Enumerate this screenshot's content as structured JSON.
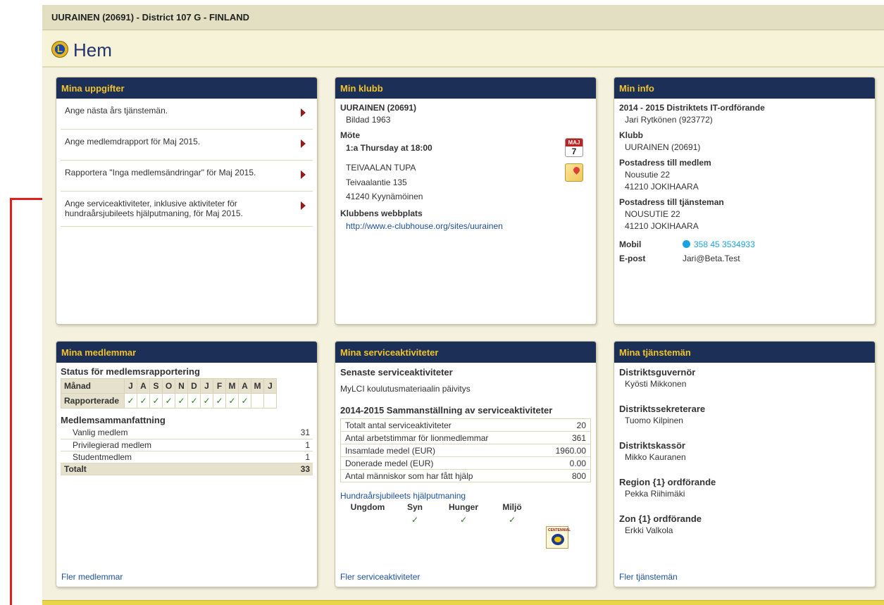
{
  "header": {
    "title": "UURAINEN (20691) - District 107 G - FINLAND",
    "page_title": "Hem",
    "logo_letter": "L"
  },
  "mina_uppgifter": {
    "title": "Mina uppgifter",
    "tasks": [
      "Ange nästa års tjänstemän.",
      "Ange medlemdrapport för Maj 2015.",
      "Rapportera \"Inga medlemsändringar\" för Maj 2015.",
      "Ange serviceaktiviteter, inklusive aktiviteter för hundraårsjubileets hjälputmaning, för Maj 2015."
    ]
  },
  "min_klubb": {
    "title": "Min klubb",
    "club": "UURAINEN (20691)",
    "founded": "Bildad 1963",
    "meeting_label": "Möte",
    "meeting_time": "1:a Thursday at 18:00",
    "cal_month": "MAJ",
    "cal_day": "7",
    "place": "TEIVAALAN TUPA",
    "street": "Teivaalantie 135",
    "postal": "41240 Kyynämöinen",
    "website_label": "Klubbens webbplats",
    "website": "http://www.e-clubhouse.org/sites/uurainen"
  },
  "min_info": {
    "title": "Min info",
    "role": "2014 - 2015 Distriktets IT-ordförande",
    "name": "Jari Rytkönen (923772)",
    "club_label": "Klubb",
    "club": "UURAINEN (20691)",
    "addr_member_label": "Postadress till medlem",
    "addr_member_1": "Nousutie 22",
    "addr_member_2": "41210 JOKIHAARA",
    "addr_officer_label": "Postadress till tjänsteman",
    "addr_officer_1": "NOUSUTIE 22",
    "addr_officer_2": "41210 JOKIHAARA",
    "mobile_label": "Mobil",
    "mobile": "358 45 3534933",
    "email_label": "E-post",
    "email": "Jari@Beta.Test"
  },
  "mina_medlemmar": {
    "title": "Mina medlemmar",
    "status_heading": "Status för medlemsrapportering",
    "month_label": "Månad",
    "months": [
      "J",
      "A",
      "S",
      "O",
      "N",
      "D",
      "J",
      "F",
      "M",
      "A",
      "M",
      "J"
    ],
    "reported_label": "Rapporterade",
    "reported": [
      "✓",
      "✓",
      "✓",
      "✓",
      "✓",
      "✓",
      "✓",
      "✓",
      "✓",
      "✓",
      "",
      ""
    ],
    "summary_heading": "Medlemsammanfattning",
    "summary": [
      {
        "label": "Vanlig medlem",
        "value": "31"
      },
      {
        "label": "Privilegierad medlem",
        "value": "1"
      },
      {
        "label": "Studentmedlem",
        "value": "1"
      }
    ],
    "total_label": "Totalt",
    "total_value": "33",
    "more_link": "Fler medlemmar"
  },
  "mina_serviceaktiviteter": {
    "title": "Mina serviceaktiviteter",
    "latest_heading": "Senaste serviceaktiviteter",
    "latest_item": "MyLCI koulutusmateriaalin päivitys",
    "summary_heading": "2014-2015 Sammanställning av serviceaktiviteter",
    "rows": [
      {
        "label": "Totalt antal serviceaktiviteter",
        "value": "20"
      },
      {
        "label": "Antal arbetstimmar för lionmedlemmar",
        "value": "361"
      },
      {
        "label": "Insamlade medel (EUR)",
        "value": "1960.00"
      },
      {
        "label": "Donerade medel (EUR)",
        "value": "0.00"
      },
      {
        "label": "Antal människor som har fått hjälp",
        "value": "800"
      }
    ],
    "centennial_link": "Hundraårsjubileets hjälputmaning",
    "centennial_badge": "CENTENNIAL",
    "focus": [
      {
        "label": "Ungdom",
        "mark": ""
      },
      {
        "label": "Syn",
        "mark": "✓"
      },
      {
        "label": "Hunger",
        "mark": "✓"
      },
      {
        "label": "Miljö",
        "mark": "✓"
      }
    ],
    "more_link": "Fler serviceaktiviteter"
  },
  "mina_tjansteman": {
    "title": "Mina tjänstemän",
    "officers": [
      {
        "role": "Distriktsguvernör",
        "name": "Kyösti Mikkonen"
      },
      {
        "role": "Distriktssekreterare",
        "name": "Tuomo Kilpinen"
      },
      {
        "role": "Distriktskassör",
        "name": "Mikko Kauranen"
      },
      {
        "role": "Region {1} ordförande",
        "name": "Pekka Riihimäki"
      },
      {
        "role": "Zon {1} ordförande",
        "name": "Erkki Valkola"
      }
    ],
    "more_link": "Fler tjänstemän"
  },
  "colors": {
    "header_bg": "#1c2f57",
    "header_text": "#f2c32b",
    "page_bg": "#f4f1de",
    "annotation_arrow": "#e02020"
  }
}
